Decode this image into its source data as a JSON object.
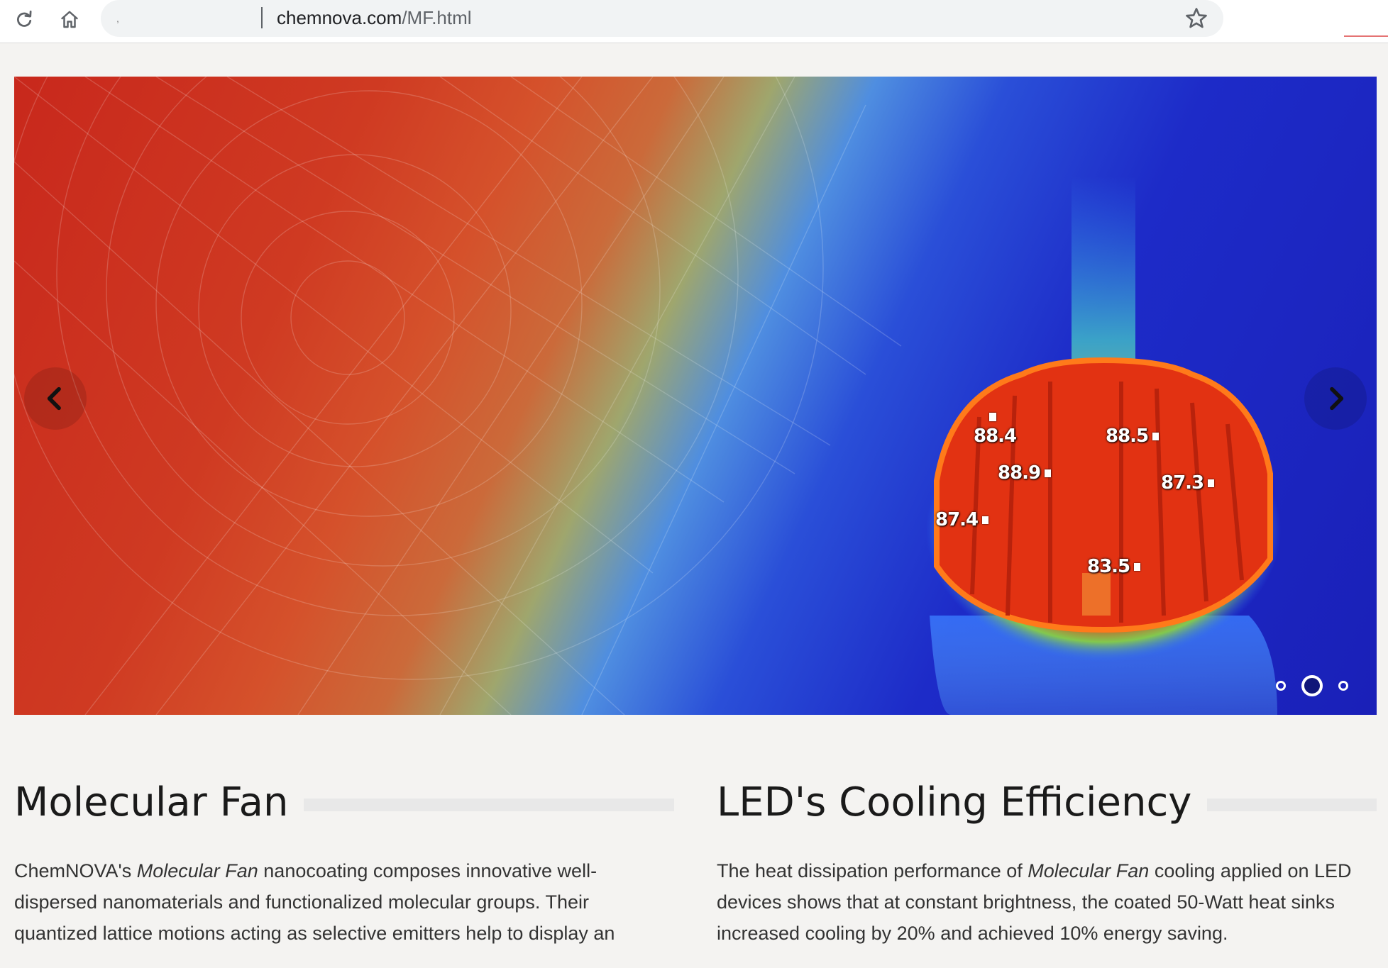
{
  "browser": {
    "url_host": "chemnova.com",
    "url_path": "/MF.html",
    "omnibox_prefix": ","
  },
  "carousel": {
    "slide_count": 3,
    "active_slide": 2,
    "temperature_labels": [
      "88.4",
      "88.5",
      "88.9",
      "87.3",
      "87.4",
      "83.5"
    ]
  },
  "sections": {
    "left": {
      "title": "Molecular Fan",
      "body_pre": "ChemNOVA's ",
      "body_em": "Molecular Fan",
      "body_post": " nanocoating composes innovative well-dispersed nanomaterials and functionalized molecular groups. Their quantized lattice motions acting as selective emitters help to display an"
    },
    "right": {
      "title": "LED's Cooling Efficiency",
      "body_pre": "The heat dissipation performance of ",
      "body_em": "Molecular Fan",
      "body_post": " cooling applied on LED devices shows that at constant brightness, the coated 50-Watt heat sinks increased cooling by 20% and achieved 10% energy saving."
    }
  },
  "colors": {
    "heat_red": "#c8281c",
    "cool_blue": "#1a20b8",
    "heading": "#1a1a1a",
    "body": "#333333"
  }
}
